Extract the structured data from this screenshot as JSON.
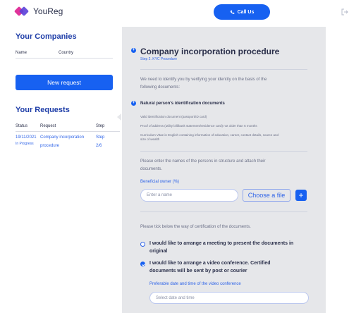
{
  "app": {
    "brand": "YouReg"
  },
  "header": {
    "call_label": "Call Us"
  },
  "sidebar": {
    "companies_title": "Your Companies",
    "companies_columns": [
      "Name",
      "Country"
    ],
    "new_request_label": "New request",
    "requests_title": "Your Requests",
    "requests_columns": [
      "Status",
      "Request",
      "Step"
    ],
    "request": {
      "date": "19/11/2021",
      "status": "In Progress",
      "name_line1": "Company incorporation",
      "name_line2": "procedure",
      "step_line1": "Step",
      "step_line2": "2/6"
    }
  },
  "main": {
    "title": "Company incorporation procedure",
    "step": "Step 2. KYC Procedure",
    "intro_line1": "We need to identify you by verifying your identity on the basis of the",
    "intro_line2": "following documents:",
    "doc_section_title": "Natural person's identification documents",
    "doc_items": [
      "Valid identification document (passport/ID card)",
      "Proof of address (utility bill/bank statement/residence card) not older than 6 months",
      "Curriculum Vitae in English containing information of education, career, contact details, source and",
      "size of wealth"
    ],
    "names_line1": "Please enter the names of the persons in structure and attach their",
    "names_line2": "documents.",
    "beneficial_label": "Beneficial owner (%)",
    "name_placeholder": "Enter a name",
    "choose_file_label": "Choose a file",
    "add_label": "+",
    "cert_text": "Please tick below the way of certification of the documents.",
    "option1_line1": "I would like to arrange a meeting to present the documents in",
    "option1_line2": "original",
    "option2_line1": "I would like to arrange a video conference. Certified",
    "option2_line2": "documents will be sent by post or courier",
    "pref_label": "Preferable date and time of the video conference",
    "date_placeholder": "Select date and time"
  },
  "colors": {
    "accent": "#1761f1",
    "panel": "#e6e7ea",
    "heading": "#1f3ea8"
  },
  "icons": {
    "call": "phone-icon",
    "logout": "logout-icon",
    "logo": "logo-icon"
  }
}
